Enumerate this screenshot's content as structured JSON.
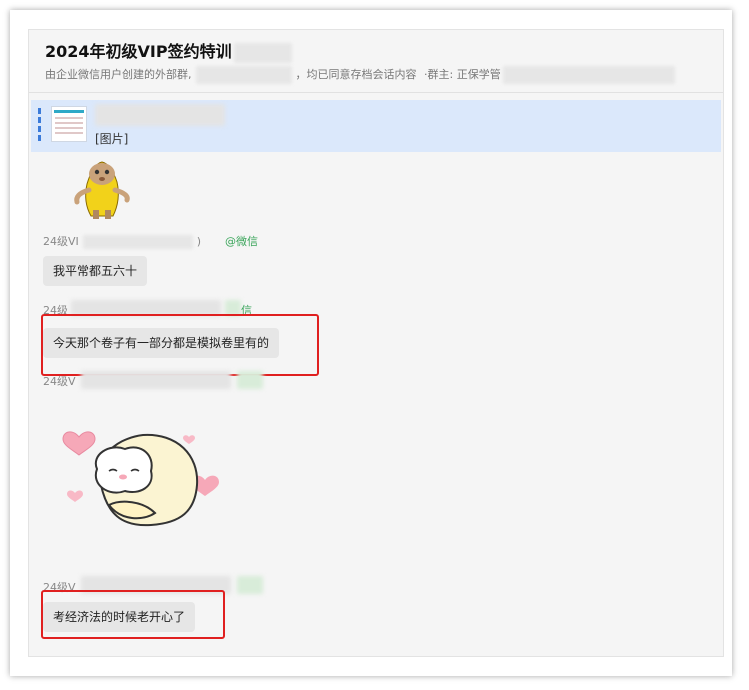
{
  "header": {
    "title": "2024年初级VIP签约特训",
    "subtitle_prefix": "由企业微信用户创建的外部群,",
    "subtitle_middle": "，均已同意存档会话内容",
    "subtitle_owner": "·群主: 正保学管"
  },
  "quote": {
    "label": "[图片]"
  },
  "messages": [
    {
      "sender": "24级VI",
      "sender_suffix": ")",
      "source": "@微信",
      "text": "我平常都五六十"
    },
    {
      "sender": "24级",
      "source": "信",
      "text": "今天那个卷子有一部分都是模拟卷里有的"
    },
    {
      "sender": "24级V"
    },
    {
      "sender": "24级V",
      "text": "考经济法的时候老开心了"
    }
  ],
  "colors": {
    "highlight": "#e02020",
    "quote_bg": "#dbe8fb",
    "source_green": "#3aa55a"
  },
  "icons": {
    "cat_sticker": "banana-cat-sticker",
    "sheep_sticker": "sheep-with-hearts-sticker"
  }
}
